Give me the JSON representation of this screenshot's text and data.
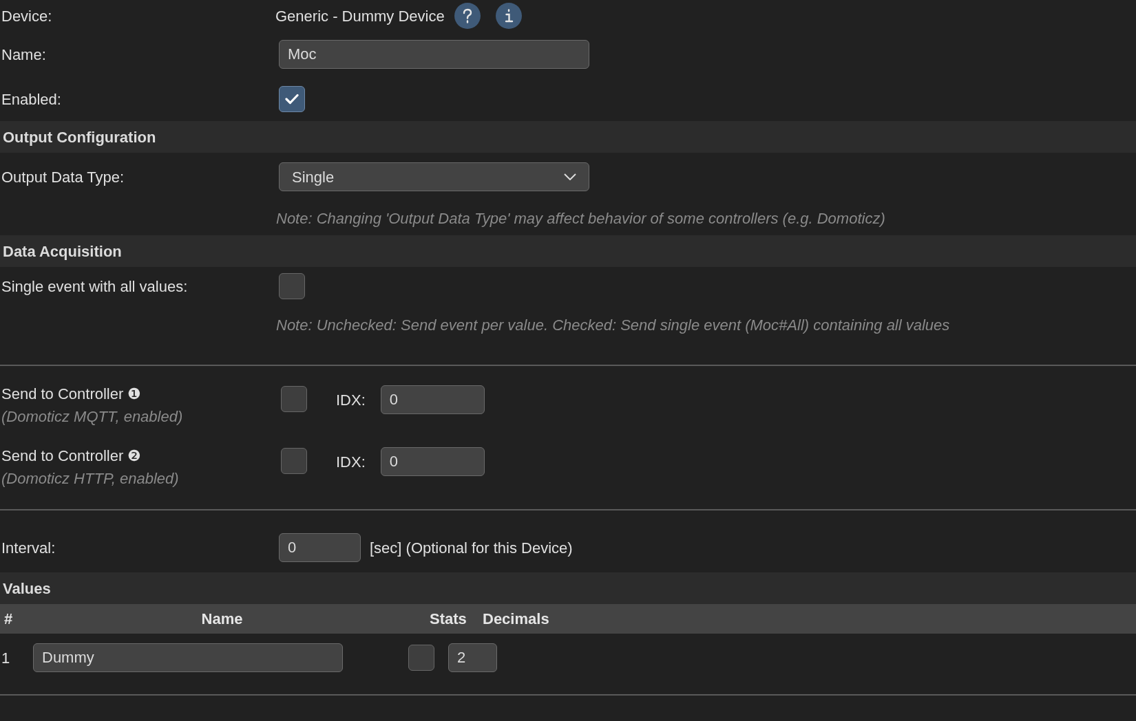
{
  "device": {
    "label": "Device:",
    "value": "Generic - Dummy Device"
  },
  "name_field": {
    "label": "Name:",
    "value": "Moc"
  },
  "enabled": {
    "label": "Enabled:",
    "checked": true
  },
  "output_configuration": {
    "heading": "Output Configuration",
    "data_type": {
      "label": "Output Data Type:",
      "value": "Single"
    },
    "note": "Note: Changing 'Output Data Type' may affect behavior of some controllers (e.g. Domoticz)"
  },
  "data_acquisition": {
    "heading": "Data Acquisition",
    "single_event": {
      "label": "Single event with all values:",
      "checked": false
    },
    "note": "Note: Unchecked: Send event per value. Checked: Send single event (Moc#All) containing all values"
  },
  "controllers": [
    {
      "label": "Send to Controller ❶",
      "detail": "(Domoticz MQTT, enabled)",
      "checked": false,
      "idx_label": "IDX:",
      "idx_value": "0"
    },
    {
      "label": "Send to Controller ❷",
      "detail": "(Domoticz HTTP, enabled)",
      "checked": false,
      "idx_label": "IDX:",
      "idx_value": "0"
    }
  ],
  "interval": {
    "label": "Interval:",
    "value": "0",
    "suffix": "[sec] (Optional for this Device)"
  },
  "values": {
    "heading": "Values",
    "columns": [
      "#",
      "Name",
      "Stats",
      "Decimals"
    ],
    "rows": [
      {
        "index": "1",
        "name": "Dummy",
        "stats": false,
        "decimals": "2"
      }
    ]
  }
}
